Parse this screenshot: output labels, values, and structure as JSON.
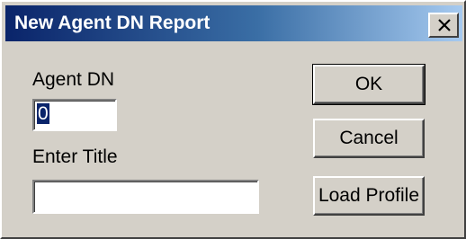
{
  "window": {
    "title": "New Agent DN Report"
  },
  "icons": {
    "close": "close-icon"
  },
  "form": {
    "agent_dn_label": "Agent DN",
    "agent_dn_value": "0",
    "enter_title_label": "Enter Title",
    "title_value": ""
  },
  "buttons": {
    "ok": "OK",
    "cancel": "Cancel",
    "load_profile": "Load Profile"
  }
}
